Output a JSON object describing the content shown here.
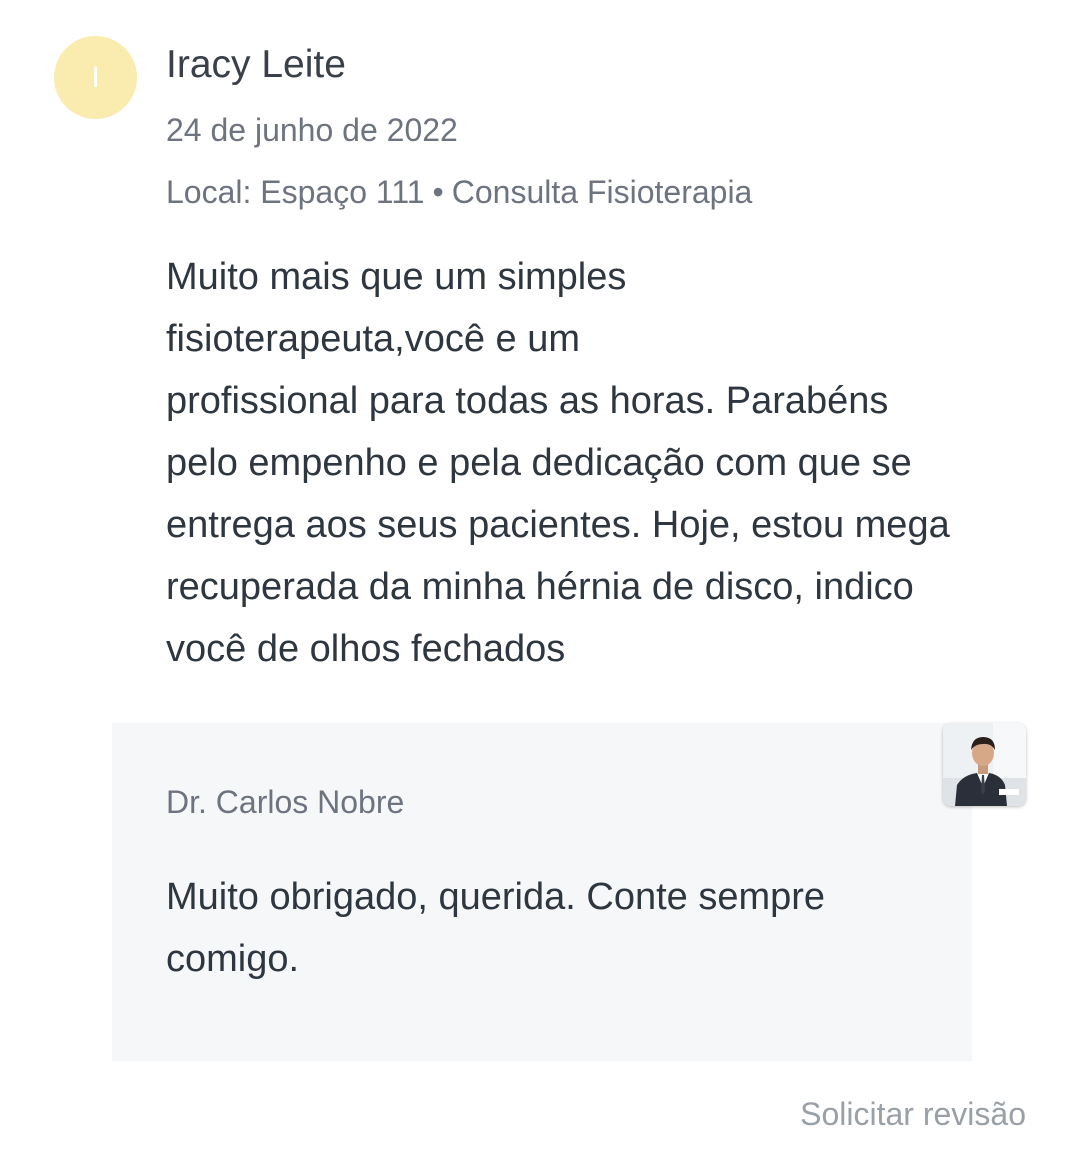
{
  "review": {
    "avatar_initial": "I",
    "author": "Iracy Leite",
    "date": "24 de junho de 2022",
    "location": "Local: Espaço 111",
    "separator": "•",
    "service": "Consulta Fisioterapia",
    "text_lines": [
      "Muito mais que um simples",
      "fisioterapeuta,você e um",
      "profissional para todas as horas. Parabéns",
      "pelo empenho e pela dedicação com que se",
      "entrega aos seus pacientes. Hoje, estou mega",
      "recuperada da minha hérnia de disco, indico",
      "você de olhos fechados"
    ]
  },
  "reply": {
    "author": "Dr. Carlos Nobre",
    "photo_icon": "doctor-photo",
    "text_lines": [
      "Muito obrigado, querida. Conte sempre",
      "comigo."
    ]
  },
  "actions": {
    "request_review": "Solicitar revisão"
  },
  "colors": {
    "avatar_bg": "#f9ecae",
    "reply_bg": "#f6f7f9",
    "muted_text": "#6d7480",
    "link_muted": "#9aa0a8"
  }
}
